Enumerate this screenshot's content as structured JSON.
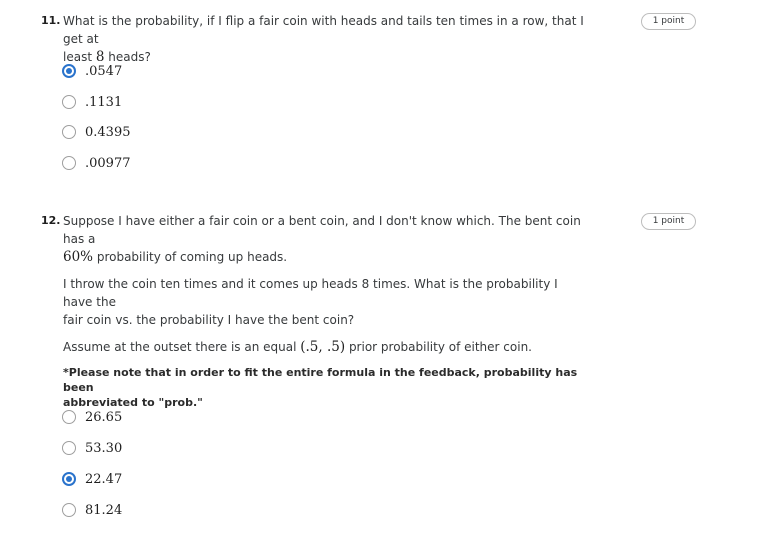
{
  "q11": {
    "number": "11.",
    "text_line1": "What is the probability, if I flip a fair coin with heads and tails ten times in a row, that I get at",
    "text_line2_pre": "least ",
    "text_line2_math": "8",
    "text_line2_post": " heads?",
    "points": "1 point",
    "options": [
      {
        "label": ".0547",
        "checked": true
      },
      {
        "label": ".1131",
        "checked": false
      },
      {
        "label": "0.4395",
        "checked": false
      },
      {
        "label": ".00977",
        "checked": false
      }
    ]
  },
  "q12": {
    "number": "12.",
    "text_line1": "Suppose I have either a fair coin or a bent coin, and I don't know which. The bent coin has a",
    "text_line2_math": "60%",
    "text_line2_post": " probability of coming up heads.",
    "para2_line1": "I throw the coin ten times and it comes up heads 8 times. What is the probability I have the",
    "para2_line2": "fair coin vs. the probability I have the bent coin?",
    "para3_pre": "Assume at the outset there is an equal ",
    "para3_math": "(.5, .5)",
    "para3_post": " prior probability of either coin.",
    "note_line1": "*Please note that in order to fit the entire formula in the feedback, probability has been",
    "note_line2": "abbreviated to \"prob.\"",
    "points": "1 point",
    "options": [
      {
        "label": "26.65",
        "checked": false
      },
      {
        "label": "53.30",
        "checked": false
      },
      {
        "label": "22.47",
        "checked": true
      },
      {
        "label": "81.24",
        "checked": false
      }
    ]
  }
}
